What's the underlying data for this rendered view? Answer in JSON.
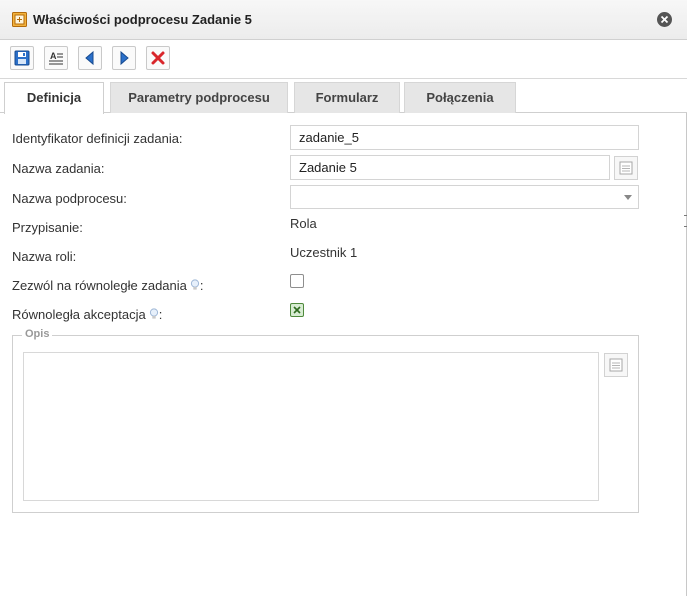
{
  "window": {
    "title": "Właściwości podprocesu Zadanie 5",
    "title_icon": "subprocess-icon",
    "close_icon": "close-icon"
  },
  "toolbar": {
    "buttons": [
      {
        "icon": "save-icon"
      },
      {
        "icon": "format-text-icon"
      },
      {
        "icon": "arrow-left-icon"
      },
      {
        "icon": "arrow-right-icon"
      },
      {
        "icon": "delete-icon"
      }
    ]
  },
  "tabs": [
    {
      "label": "Definicja",
      "active": true
    },
    {
      "label": "Parametry podprocesu",
      "active": false
    },
    {
      "label": "Formularz",
      "active": false
    },
    {
      "label": "Połączenia",
      "active": false
    }
  ],
  "form": {
    "task_definition_id": {
      "label": "Identyfikator definicji zadania:",
      "value": "zadanie_5"
    },
    "task_name": {
      "label": "Nazwa zadania:",
      "value": "Zadanie 5"
    },
    "subprocess_name": {
      "label": "Nazwa podprocesu:",
      "value": ""
    },
    "assignment": {
      "label": "Przypisanie:",
      "value": "Rola"
    },
    "role_name": {
      "label": "Nazwa roli:",
      "value": "Uczestnik 1"
    },
    "allow_parallel": {
      "label": "Zezwól na równoległe zadania",
      "suffix": ":",
      "checked": false
    },
    "parallel_acceptance": {
      "label": "Równoległa akceptacja",
      "suffix": ":",
      "checked": true
    }
  },
  "description": {
    "legend": "Opis",
    "value": ""
  },
  "colors": {
    "accent_blue": "#2a6fc9",
    "delete_red": "#d9262b",
    "check_green": "#4f8a3c",
    "icon_orange": "#e8a12a"
  }
}
